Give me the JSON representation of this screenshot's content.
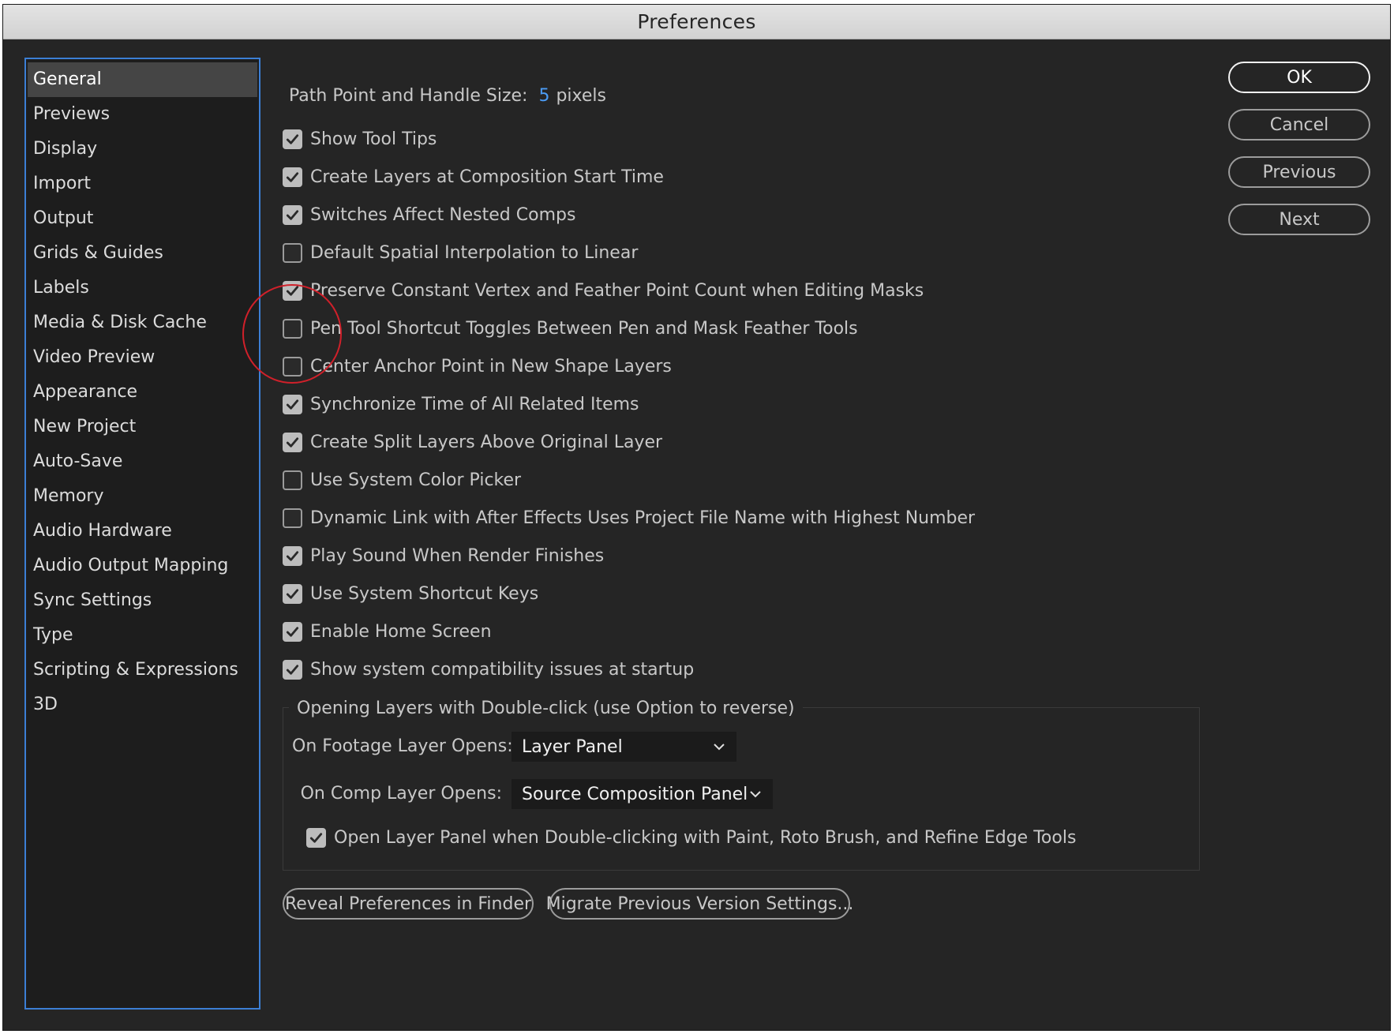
{
  "window": {
    "title": "Preferences"
  },
  "sidebar": {
    "items": [
      {
        "label": "General",
        "selected": true
      },
      {
        "label": "Previews"
      },
      {
        "label": "Display"
      },
      {
        "label": "Import"
      },
      {
        "label": "Output"
      },
      {
        "label": "Grids & Guides"
      },
      {
        "label": "Labels"
      },
      {
        "label": "Media & Disk Cache"
      },
      {
        "label": "Video Preview"
      },
      {
        "label": "Appearance"
      },
      {
        "label": "New Project"
      },
      {
        "label": "Auto-Save"
      },
      {
        "label": "Memory"
      },
      {
        "label": "Audio Hardware"
      },
      {
        "label": "Audio Output Mapping"
      },
      {
        "label": "Sync Settings"
      },
      {
        "label": "Type"
      },
      {
        "label": "Scripting & Expressions"
      },
      {
        "label": "3D"
      }
    ]
  },
  "general": {
    "path_point_label": "Path Point and Handle Size:",
    "path_point_value": "5",
    "path_point_unit": "pixels",
    "checkboxes": [
      {
        "label": "Show Tool Tips",
        "checked": true
      },
      {
        "label": "Create Layers at Composition Start Time",
        "checked": true
      },
      {
        "label": "Switches Affect Nested Comps",
        "checked": true
      },
      {
        "label": "Default Spatial Interpolation to Linear",
        "checked": false
      },
      {
        "label": "Preserve Constant Vertex and Feather Point Count when Editing Masks",
        "checked": true
      },
      {
        "label": "Pen Tool Shortcut Toggles Between Pen and Mask Feather Tools",
        "checked": false
      },
      {
        "label": "Center Anchor Point in New Shape Layers",
        "checked": false
      },
      {
        "label": "Synchronize Time of All Related Items",
        "checked": true
      },
      {
        "label": "Create Split Layers Above Original Layer",
        "checked": true
      },
      {
        "label": "Use System Color Picker",
        "checked": false
      },
      {
        "label": "Dynamic Link with After Effects Uses Project File Name with Highest Number",
        "checked": false
      },
      {
        "label": "Play Sound When Render Finishes",
        "checked": true
      },
      {
        "label": "Use System Shortcut Keys",
        "checked": true
      },
      {
        "label": "Enable Home Screen",
        "checked": true
      },
      {
        "label": "Show system compatibility issues at startup",
        "checked": true
      }
    ],
    "opening_group": {
      "title": "Opening Layers with Double-click (use Option to reverse)",
      "footage_label": "On Footage Layer Opens:",
      "footage_value": "Layer Panel",
      "comp_label": "On Comp Layer Opens:",
      "comp_value": "Source Composition Panel",
      "open_layer_panel_label": "Open Layer Panel when Double-clicking with Paint, Roto Brush, and Refine Edge Tools",
      "open_layer_panel_checked": true
    },
    "reveal_button": "Reveal Preferences in Finder",
    "migrate_button": "Migrate Previous Version Settings..."
  },
  "buttons": {
    "ok": "OK",
    "cancel": "Cancel",
    "previous": "Previous",
    "next": "Next"
  },
  "colors": {
    "accent": "#4b9cf5",
    "selection_border": "#3c7fd5",
    "annotation_circle": "#d0202a"
  }
}
